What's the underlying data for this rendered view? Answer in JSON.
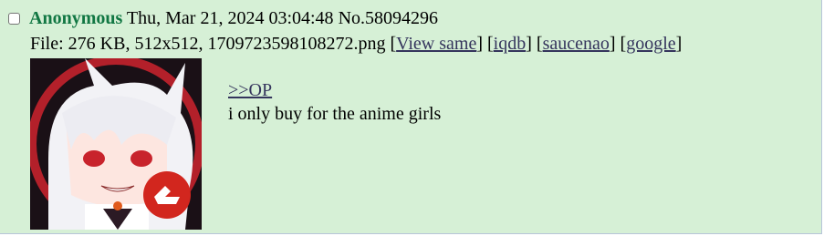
{
  "post": {
    "name": "Anonymous",
    "datetime": "Thu, Mar 21, 2024 03:04:48",
    "number": "No.58094296",
    "file": {
      "prefix": "File: 276 KB, 512x512, 1709723598108272.png",
      "links": [
        "View same",
        "iqdb",
        "saucenao",
        "google"
      ]
    },
    "quote": ">>OP",
    "message": "i only buy for the anime girls"
  },
  "colors": {
    "background": "#d6f0d6",
    "name": "#117743",
    "link": "#34345c"
  }
}
